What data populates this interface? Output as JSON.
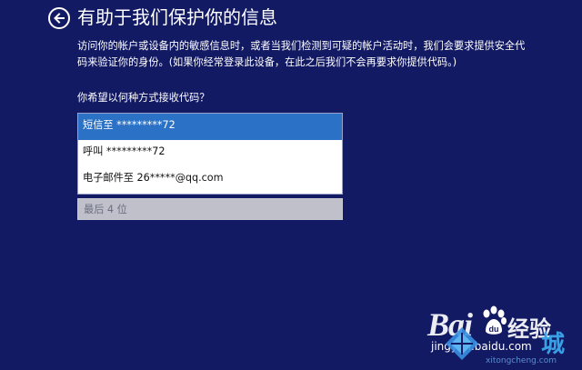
{
  "header": {
    "title": "有助于我们保护你的信息"
  },
  "body": {
    "description": "访问你的帐户或设备内的敏感信息时，或者当我们检测到可疑的帐户活动时，我们会要求提供安全代码来验证你的身份。(如果你经常登录此设备，在此之后我们不会再要求你提供代码。)",
    "question": "你希望以何种方式接收代码？"
  },
  "options": {
    "items": [
      {
        "label": "短信至 *********72",
        "selected": true
      },
      {
        "label": "呼叫 *********72",
        "selected": false
      },
      {
        "label": "电子邮件至 26*****@qq.com",
        "selected": false
      }
    ]
  },
  "code_input": {
    "placeholder": "最后 4 位",
    "value": ""
  },
  "watermark": {
    "baidu_text": "Bai",
    "jingyan_text": "经验",
    "baidu_url": "jingyan.baidu.com",
    "site_char": "城",
    "site_url": "xitongcheng.com"
  },
  "colors": {
    "background": "#131a64",
    "selected_option": "#2b72c6",
    "input_background": "#bfc0ca"
  }
}
